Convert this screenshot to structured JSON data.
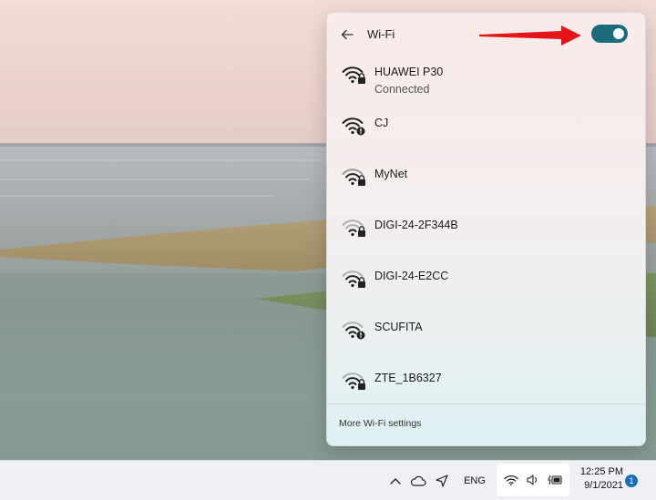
{
  "flyout": {
    "title": "Wi-Fi",
    "toggle_on": true,
    "networks": [
      {
        "name": "HUAWEI P30",
        "status": "Connected",
        "icon": "wifi-lock-icon"
      },
      {
        "name": "CJ",
        "status": "",
        "icon": "wifi-warning-icon"
      },
      {
        "name": "MyNet",
        "status": "",
        "icon": "wifi-lock-icon"
      },
      {
        "name": "DIGI-24-2F344B",
        "status": "",
        "icon": "wifi-lock-icon"
      },
      {
        "name": "DIGI-24-E2CC",
        "status": "",
        "icon": "wifi-lock-icon"
      },
      {
        "name": "SCUFITA",
        "status": "",
        "icon": "wifi-warning-icon"
      },
      {
        "name": "ZTE_1B6327",
        "status": "",
        "icon": "wifi-lock-icon"
      }
    ],
    "more_settings": "More Wi-Fi settings"
  },
  "taskbar": {
    "language": "ENG",
    "time": "12:25 PM",
    "date": "9/1/2021",
    "notification_count": "1"
  },
  "colors": {
    "toggle_on": "#1b6b7d",
    "arrow": "#e3151b",
    "notification": "#1a6fb6"
  }
}
